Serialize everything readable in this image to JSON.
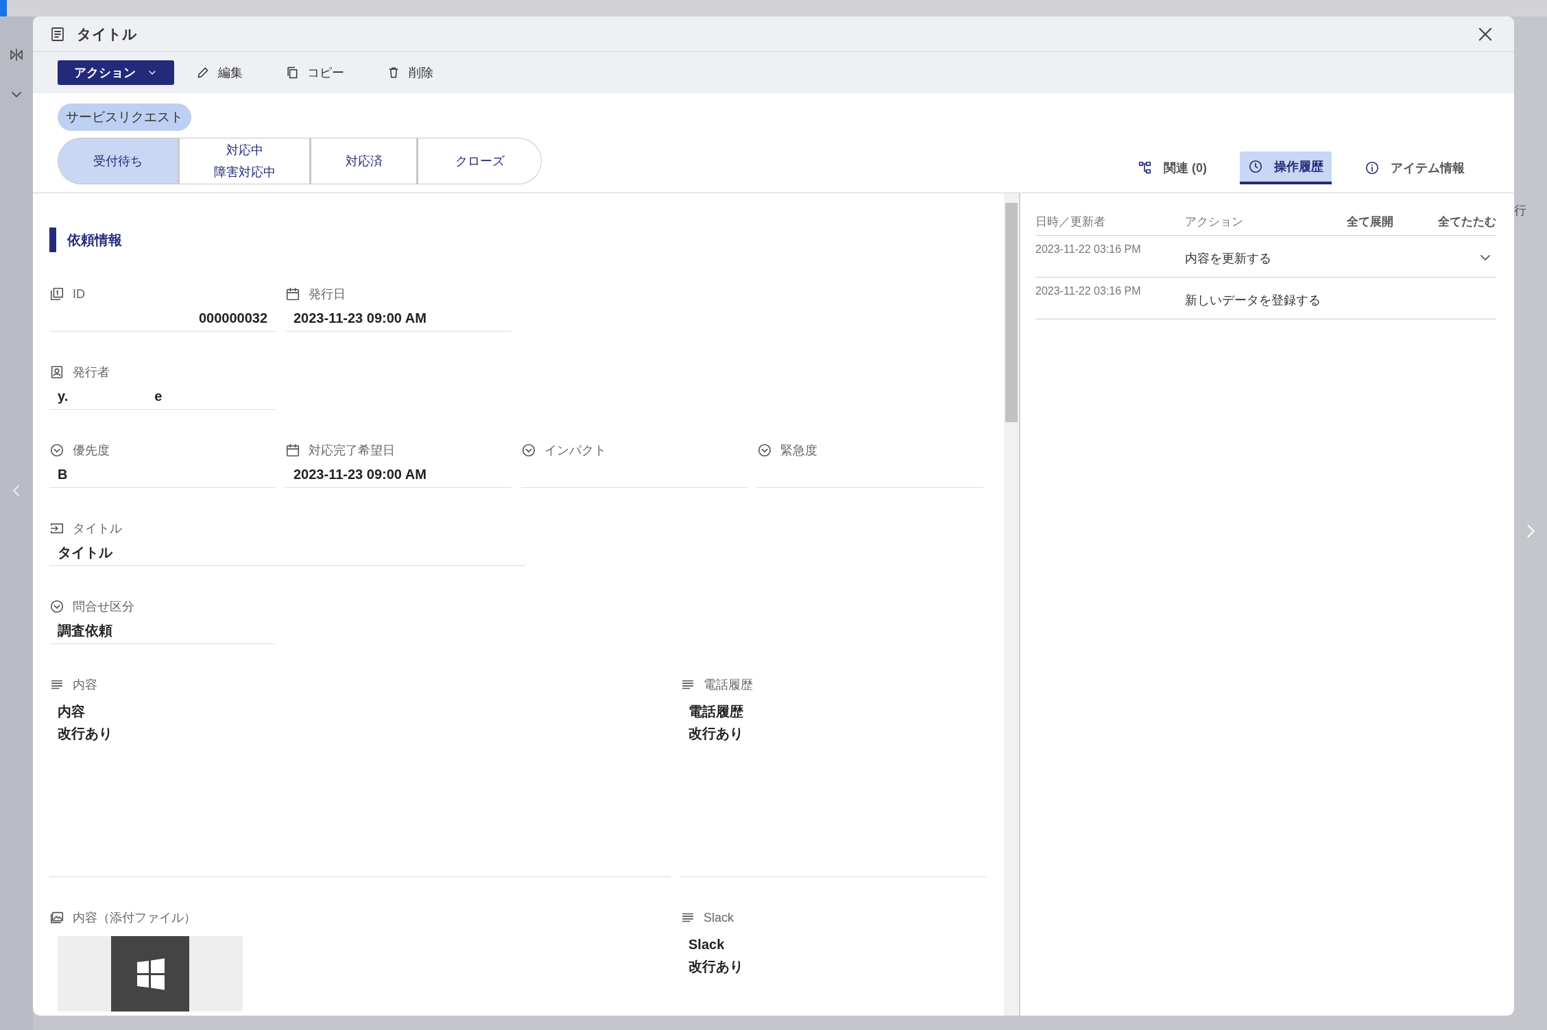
{
  "background": {
    "side_text": "行"
  },
  "dialog": {
    "title": "タイトル"
  },
  "toolbar": {
    "action_menu": "アクション",
    "buttons": [
      {
        "kind": "edit",
        "label": "編集"
      },
      {
        "kind": "copy",
        "label": "コピー"
      },
      {
        "kind": "delete",
        "label": "削除"
      }
    ]
  },
  "category_badge": "サービスリクエスト",
  "steps": [
    {
      "lines": [
        "受付待ち"
      ],
      "selected": true
    },
    {
      "lines": [
        "対応中",
        "障害対応中"
      ],
      "selected": false
    },
    {
      "lines": [
        "対応済"
      ],
      "selected": false
    },
    {
      "lines": [
        "クローズ"
      ],
      "selected": false
    }
  ],
  "side_tabs": [
    {
      "kind": "related",
      "label": "関連 (0)",
      "selected": false
    },
    {
      "kind": "history",
      "label": "操作履歴",
      "selected": true
    },
    {
      "kind": "info",
      "label": "アイテム情報",
      "selected": false
    }
  ],
  "section": {
    "title": "依頼情報"
  },
  "rows": [
    [
      {
        "kind": "number",
        "label": "ID",
        "value": [
          "000000032"
        ]
      },
      {
        "kind": "date",
        "label": "発行日",
        "value": [
          "2023-11-23 09:00 AM"
        ]
      }
    ],
    [
      {
        "kind": "user",
        "label": "発行者",
        "value": [
          "y.",
          "e"
        ]
      }
    ],
    [
      {
        "kind": "select",
        "label": "優先度",
        "value": [
          "B"
        ]
      },
      {
        "kind": "date",
        "label": "対応完了希望日",
        "value": [
          "2023-11-23 09:00 AM"
        ]
      },
      {
        "kind": "select",
        "label": "インパクト"
      },
      {
        "kind": "select",
        "label": "緊急度"
      }
    ],
    [
      {
        "kind": "text",
        "label": "タイトル",
        "value": [
          "タイトル"
        ]
      }
    ],
    [
      {
        "kind": "select",
        "label": "問合せ区分",
        "value": [
          "調査依頼"
        ]
      }
    ],
    [
      {
        "kind": "multiline",
        "label": "内容",
        "value": [
          "内容",
          "改行あり"
        ]
      },
      {
        "kind": "multiline",
        "label": "電話履歴",
        "value": [
          "電話履歴",
          "改行あり"
        ]
      }
    ],
    [
      {
        "kind": "attachment",
        "label": "内容（添付ファイル）"
      },
      {
        "kind": "multiline",
        "label": "Slack",
        "value": [
          "Slack",
          "改行あり"
        ]
      }
    ]
  ],
  "history": {
    "columns": [
      "日時／更新者",
      "アクション"
    ],
    "buttons": [
      "全て展開",
      "全てたたむ"
    ],
    "rows": [
      {
        "time": "2023-11-22 03:16 PM",
        "action": "内容を更新する",
        "expandable": true
      },
      {
        "time": "2023-11-22 03:16 PM",
        "action": "新しいデータを登録する",
        "expandable": false
      }
    ]
  }
}
